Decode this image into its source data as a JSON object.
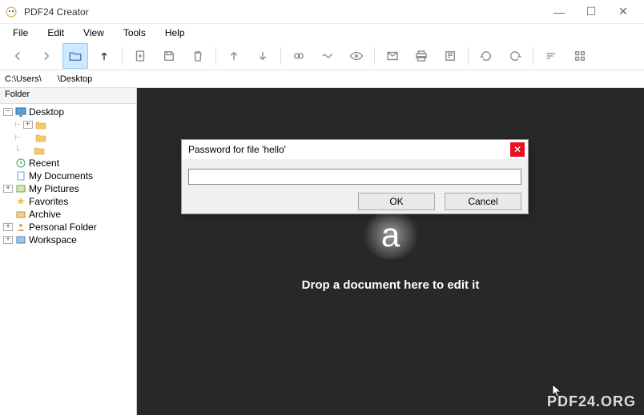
{
  "window": {
    "title": "PDF24 Creator",
    "min_tip": "Minimize",
    "max_tip": "Maximize",
    "close_tip": "Close"
  },
  "menubar": [
    "File",
    "Edit",
    "View",
    "Tools",
    "Help"
  ],
  "toolbar": {
    "back": "back",
    "forward": "forward",
    "open_folder": "open-folder",
    "up": "up-level",
    "new_doc": "new-document",
    "save": "save",
    "delete": "delete",
    "page_up": "page-up",
    "page_down": "page-down",
    "chain": "link",
    "wave": "mask",
    "eye": "view",
    "mail": "email",
    "print": "print",
    "fax": "fax",
    "rot_ccw": "rotate-ccw",
    "rot_cw": "rotate-cw",
    "sort": "sort",
    "grid": "grid-view"
  },
  "path": {
    "segment1": "C:\\Users\\",
    "segment2": "\\Desktop"
  },
  "sidebar": {
    "header": "Folder",
    "desktop": "Desktop",
    "recent": "Recent",
    "my_documents": "My Documents",
    "my_pictures": "My Pictures",
    "favorites": "Favorites",
    "archive": "Archive",
    "personal_folder": "Personal Folder",
    "workspace": "Workspace"
  },
  "dropzone": {
    "logo_glyph": "a",
    "text": "Drop a document here to edit it"
  },
  "dialog": {
    "title": "Password for file 'hello'",
    "input_value": "",
    "ok": "OK",
    "cancel": "Cancel"
  },
  "watermark": "PDF24.ORG"
}
